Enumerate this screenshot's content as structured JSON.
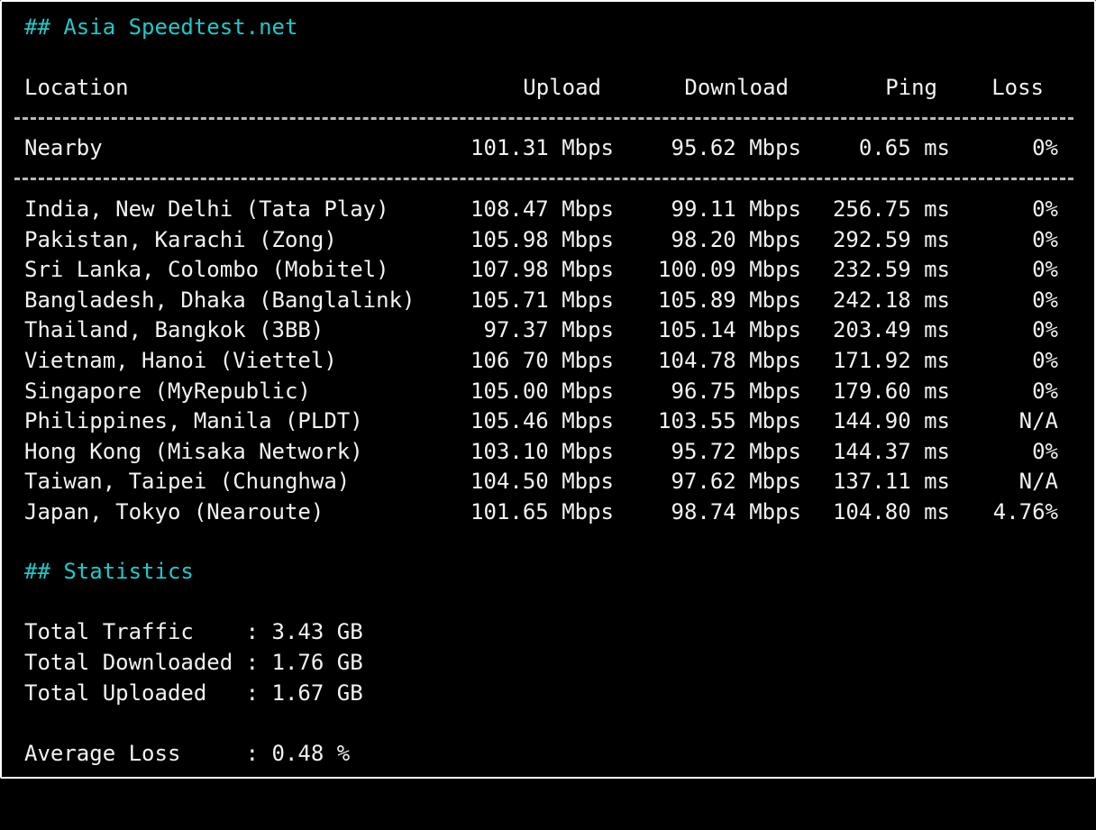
{
  "speedtest": {
    "heading": "## Asia Speedtest.net",
    "columns": {
      "location": "Location",
      "upload": "Upload",
      "download": "Download",
      "ping": "Ping",
      "loss": "Loss"
    },
    "nearby": {
      "location": "Nearby",
      "upload": "101.31 Mbps",
      "download": "95.62 Mbps",
      "ping": "0.65 ms",
      "loss": "0%"
    },
    "rows": [
      {
        "location": "India, New Delhi (Tata Play)",
        "upload": "108.47 Mbps",
        "download": "99.11 Mbps",
        "ping": "256.75 ms",
        "loss": "0%"
      },
      {
        "location": "Pakistan, Karachi (Zong)",
        "upload": "105.98 Mbps",
        "download": "98.20 Mbps",
        "ping": "292.59 ms",
        "loss": "0%"
      },
      {
        "location": "Sri Lanka, Colombo (Mobitel)",
        "upload": "107.98 Mbps",
        "download": "100.09 Mbps",
        "ping": "232.59 ms",
        "loss": "0%"
      },
      {
        "location": "Bangladesh, Dhaka (Banglalink)",
        "upload": "105.71 Mbps",
        "download": "105.89 Mbps",
        "ping": "242.18 ms",
        "loss": "0%"
      },
      {
        "location": "Thailand, Bangkok (3BB)",
        "upload": "97.37 Mbps",
        "download": "105.14 Mbps",
        "ping": "203.49 ms",
        "loss": "0%"
      },
      {
        "location": "Vietnam, Hanoi (Viettel)",
        "upload": "106 70 Mbps",
        "download": "104.78 Mbps",
        "ping": "171.92 ms",
        "loss": "0%"
      },
      {
        "location": "Singapore (MyRepublic)",
        "upload": "105.00 Mbps",
        "download": "96.75 Mbps",
        "ping": "179.60 ms",
        "loss": "0%"
      },
      {
        "location": "Philippines, Manila (PLDT)",
        "upload": "105.46 Mbps",
        "download": "103.55 Mbps",
        "ping": "144.90 ms",
        "loss": "N/A"
      },
      {
        "location": "Hong Kong (Misaka Network)",
        "upload": "103.10 Mbps",
        "download": "95.72 Mbps",
        "ping": "144.37 ms",
        "loss": "0%"
      },
      {
        "location": "Taiwan, Taipei (Chunghwa)",
        "upload": "104.50 Mbps",
        "download": "97.62 Mbps",
        "ping": "137.11 ms",
        "loss": "N/A"
      },
      {
        "location": "Japan, Tokyo (Nearoute)",
        "upload": "101.65 Mbps",
        "download": "98.74 Mbps",
        "ping": "104.80 ms",
        "loss": "4.76%"
      }
    ]
  },
  "statistics": {
    "heading": "## Statistics",
    "total_traffic": "Total Traffic    : 3.43 GB",
    "total_downloaded": "Total Downloaded : 1.76 GB",
    "total_uploaded": "Total Uploaded   : 1.67 GB",
    "average_loss": "Average Loss     : 0.48 %"
  },
  "colors": {
    "background": "#000000",
    "text": "#f2f2f2",
    "heading": "#1fc9c9"
  }
}
